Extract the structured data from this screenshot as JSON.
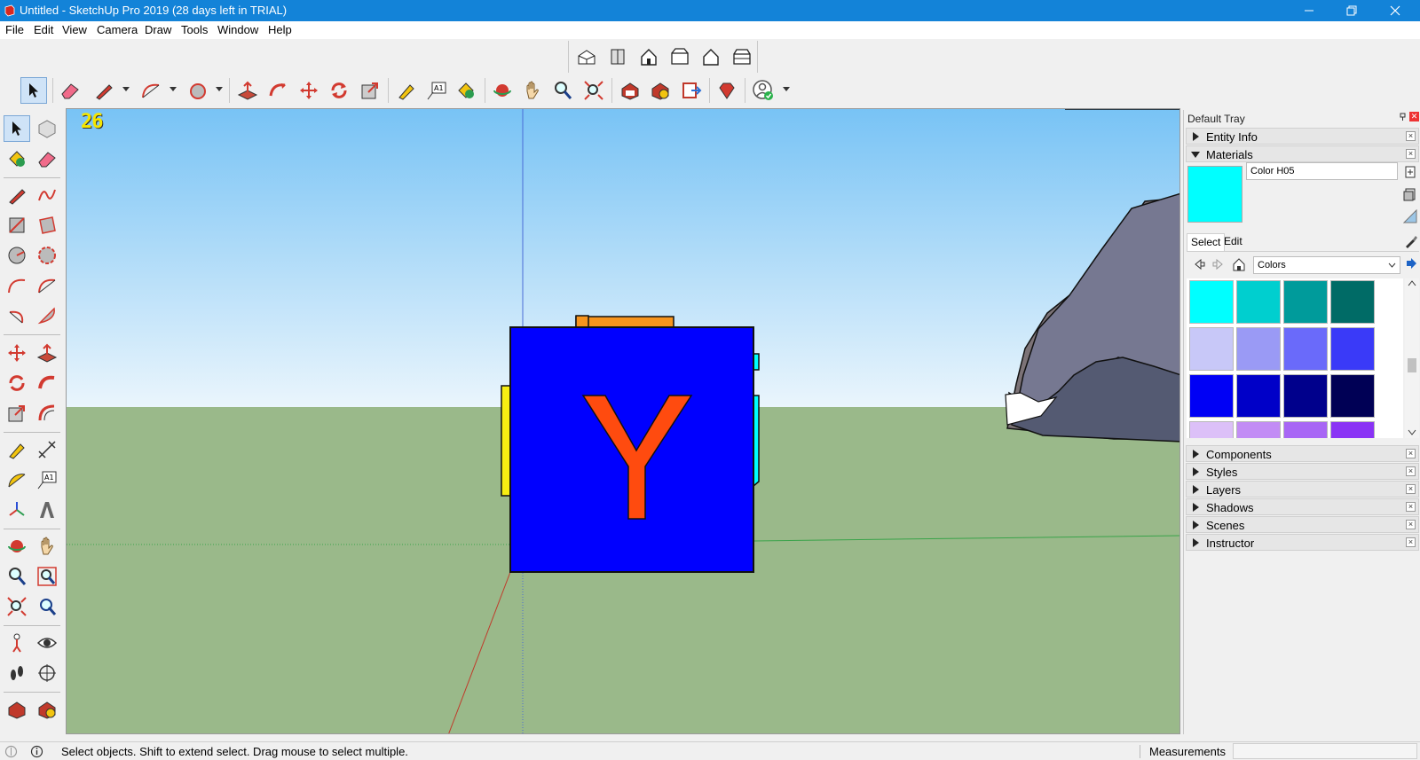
{
  "window": {
    "title": "Untitled - SketchUp Pro 2019 (28 days left in TRIAL)",
    "controls": [
      "minimize-icon",
      "restore-icon",
      "close-icon"
    ]
  },
  "menu": {
    "items": [
      "File",
      "Edit",
      "View",
      "Camera",
      "Draw",
      "Tools",
      "Window",
      "Help"
    ]
  },
  "toolbar_views": {
    "icons": [
      "iso-view-icon",
      "top-view-icon",
      "front-view-icon",
      "right-view-icon",
      "back-view-icon",
      "left-view-icon"
    ]
  },
  "toolbar_main": {
    "icons": [
      "select-icon",
      "eraser-icon",
      "line-icon",
      "arc-icon",
      "shape-icon",
      "push-pull-icon",
      "follow-me-icon",
      "move-icon",
      "rotate-icon",
      "scale-icon",
      "tape-measure-icon",
      "text-icon",
      "paint-bucket-icon",
      "orbit-icon",
      "pan-icon",
      "zoom-icon",
      "zoom-extents-icon",
      "warehouse-icon",
      "extension-warehouse-icon",
      "layout-icon",
      "extension-manager-icon",
      "account-icon"
    ],
    "active": "select-icon"
  },
  "viewport": {
    "fps_label": "26",
    "colors": {
      "sky_top": "#7ec6f5",
      "sky_horizon": "#e7f3fb",
      "ground": "#9ab98a",
      "cube_face": "#0000ff",
      "letter": "#ff4b0f",
      "blue_axis": "#4a6cd6",
      "red_axis": "#c03a2a",
      "green_axis": "#3aa34a"
    },
    "cube_letter": "Y"
  },
  "tray": {
    "title": "Default Tray",
    "panels": {
      "entity_info": "Entity Info",
      "materials": "Materials",
      "components": "Components",
      "styles": "Styles",
      "layers": "Layers",
      "shadows": "Shadows",
      "scenes": "Scenes",
      "instructor": "Instructor"
    },
    "materials": {
      "name": "Color H05",
      "preview_color": "#00ffff",
      "tab_select": "Select",
      "tab_edit": "Edit",
      "library": "Colors",
      "swatches": [
        "#00ffff",
        "#00cfcf",
        "#009b9b",
        "#006b66",
        "#c8c8f8",
        "#9a9af5",
        "#6a6afa",
        "#3a3af8",
        "#0000f5",
        "#0000c8",
        "#00008c",
        "#000055",
        "#dcc0f8",
        "#c28cf5",
        "#a866f5",
        "#8a33f5"
      ]
    }
  },
  "status": {
    "message": "Select objects. Shift to extend select. Drag mouse to select multiple.",
    "measurements_label": "Measurements",
    "measurements_value": ""
  }
}
